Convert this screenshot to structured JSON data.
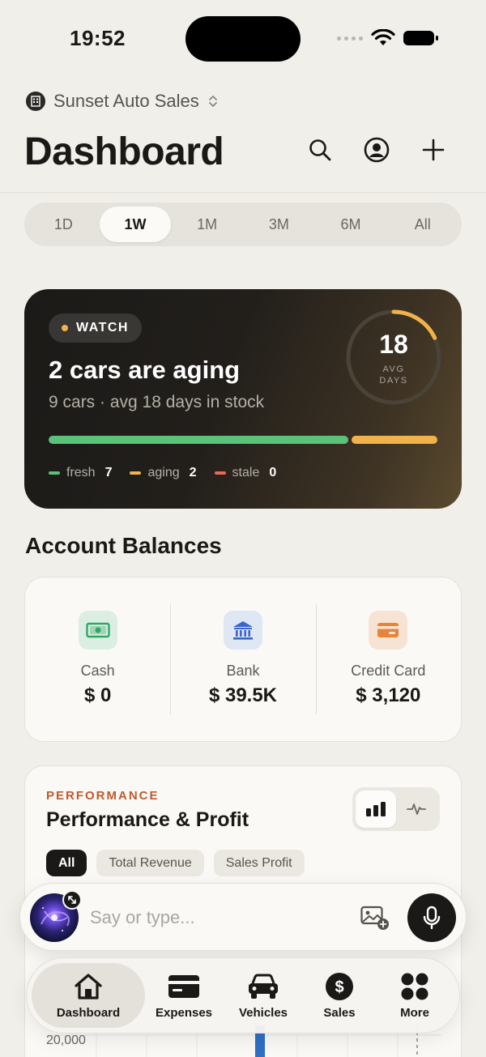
{
  "status_bar": {
    "time": "19:52"
  },
  "header": {
    "org_name": "Sunset Auto Sales",
    "title": "Dashboard",
    "icons": [
      "search-icon",
      "account-icon",
      "plus-icon"
    ]
  },
  "range_tabs": [
    {
      "label": "1D",
      "active": false
    },
    {
      "label": "1W",
      "active": true
    },
    {
      "label": "1M",
      "active": false
    },
    {
      "label": "3M",
      "active": false
    },
    {
      "label": "6M",
      "active": false
    },
    {
      "label": "All",
      "active": false
    }
  ],
  "aging_card": {
    "badge": "WATCH",
    "title": "2 cars are aging",
    "subtitle": "9 cars · avg 18 days in stock",
    "avg_days": "18",
    "avg_label_line1": "AVG",
    "avg_label_line2": "DAYS",
    "ring_progress": 0.18,
    "legend": [
      {
        "label": "fresh",
        "count": "7",
        "color": "#5bc27a"
      },
      {
        "label": "aging",
        "count": "2",
        "color": "#f0b24a"
      },
      {
        "label": "stale",
        "count": "0",
        "color": "#e86a5a"
      }
    ]
  },
  "balances": {
    "title": "Account Balances",
    "items": [
      {
        "label": "Cash",
        "value": "$ 0",
        "icon": "cash-icon",
        "icon_bg": "#dbeee2",
        "icon_color": "#2fa866"
      },
      {
        "label": "Bank",
        "value": "$ 39.5K",
        "icon": "bank-icon",
        "icon_bg": "#dfe6f4",
        "icon_color": "#3a66c9"
      },
      {
        "label": "Credit Card",
        "value": "$ 3,120",
        "icon": "credit-card-icon",
        "icon_bg": "#f6e3d4",
        "icon_color": "#e8833a"
      }
    ]
  },
  "performance": {
    "kicker": "PERFORMANCE",
    "title": "Performance & Profit",
    "chips": [
      {
        "label": "All",
        "active": true
      },
      {
        "label": "Total Revenue",
        "active": false
      },
      {
        "label": "Sales Profit",
        "active": false
      }
    ],
    "y_tick": "20,000"
  },
  "assistant": {
    "placeholder": "Say or type..."
  },
  "tabbar": [
    {
      "label": "Dashboard",
      "icon": "home-icon",
      "active": true
    },
    {
      "label": "Expenses",
      "icon": "wallet-icon",
      "active": false
    },
    {
      "label": "Vehicles",
      "icon": "car-icon",
      "active": false
    },
    {
      "label": "Sales",
      "icon": "dollar-icon",
      "active": false
    },
    {
      "label": "More",
      "icon": "grid-icon",
      "active": false
    }
  ],
  "colors": {
    "background": "#f1efe9",
    "accent_orange": "#c0592b",
    "fresh": "#5bc27a",
    "aging": "#f0b24a",
    "stale": "#e86a5a"
  }
}
